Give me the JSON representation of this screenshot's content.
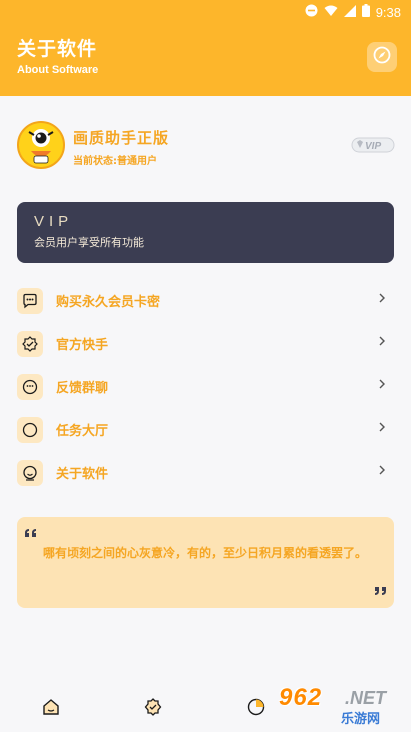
{
  "status_bar": {
    "time": "9:38"
  },
  "header": {
    "title": "关于软件",
    "subtitle": "About Software"
  },
  "profile": {
    "name": "画质助手正版",
    "status": "当前状态:普通用户",
    "badge": "VIP"
  },
  "vip_card": {
    "title": "VIP",
    "description": "会员用户享受所有功能"
  },
  "menu": [
    {
      "label": "购买永久会员卡密",
      "icon": "chat-icon"
    },
    {
      "label": "官方快手",
      "icon": "check-badge-icon"
    },
    {
      "label": "反馈群聊",
      "icon": "smile-icon"
    },
    {
      "label": "任务大厅",
      "icon": "circle-icon"
    },
    {
      "label": "关于软件",
      "icon": "info-icon"
    }
  ],
  "quote": {
    "text": "哪有顷刻之间的心灰意冷，有的，至少日积月累的看透罢了。"
  },
  "bottom_nav": [
    {
      "icon": "home-icon"
    },
    {
      "icon": "badge-icon"
    },
    {
      "icon": "chart-icon"
    }
  ],
  "watermark": {
    "number": "962",
    "net": ".NET",
    "cn": "乐游网"
  },
  "colors": {
    "primary": "#fdb62b",
    "accent_text": "#f5a623",
    "vip_card": "#3b3d52",
    "quote_bg": "#fde3b4"
  }
}
